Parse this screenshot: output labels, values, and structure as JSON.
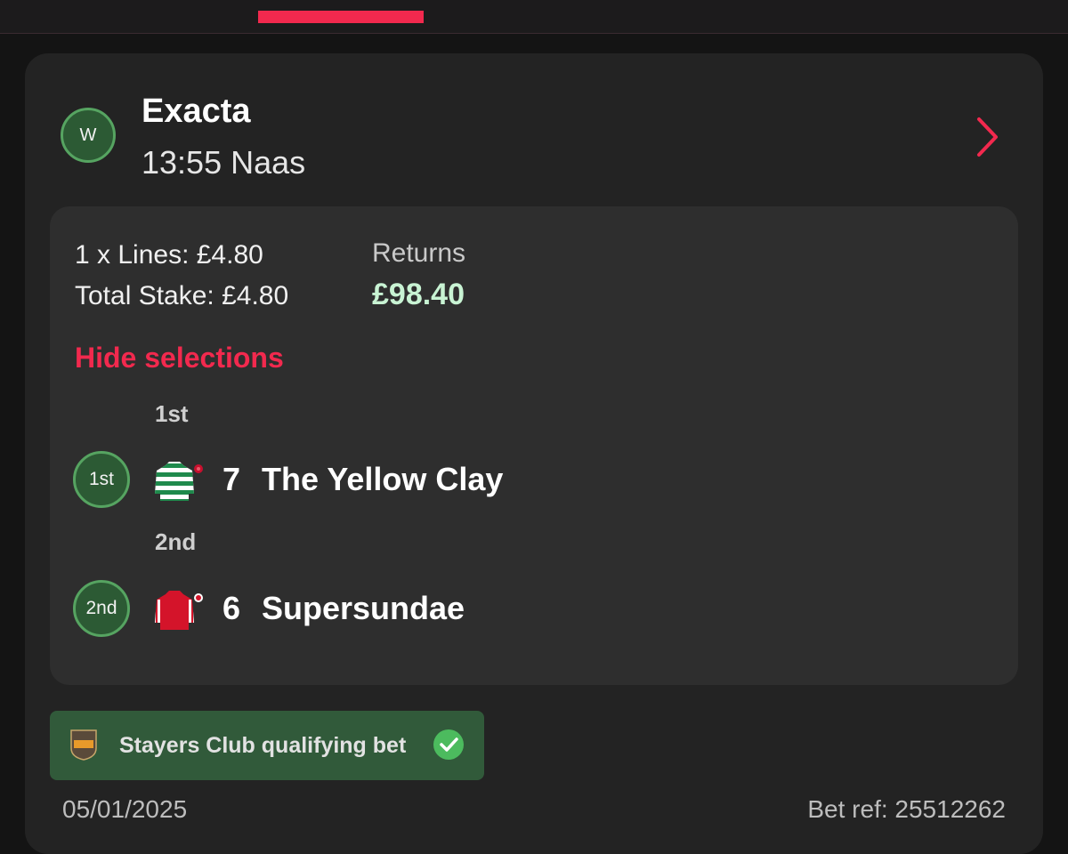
{
  "bet": {
    "status_badge": "W",
    "title": "Exacta",
    "subtitle": "13:55 Naas"
  },
  "summary": {
    "lines": "1 x Lines: £4.80",
    "total_stake": "Total Stake: £4.80",
    "returns_label": "Returns",
    "returns_value": "£98.40",
    "hide_selections": "Hide selections"
  },
  "selections": [
    {
      "position_label": "1st",
      "badge": "1st",
      "silk_icon": "green-white-hooped-silks-icon",
      "number": "7",
      "name": "The Yellow Clay"
    },
    {
      "position_label": "2nd",
      "badge": "2nd",
      "silk_icon": "red-white-striped-silks-icon",
      "number": "6",
      "name": "Supersundae"
    }
  ],
  "club": {
    "logo_icon": "stayers-club-shield-icon",
    "text": "Stayers Club qualifying bet",
    "check_icon": "green-check-icon"
  },
  "footer": {
    "date": "05/01/2025",
    "bet_ref": "Bet ref: 25512262"
  },
  "colors": {
    "accent": "#f2294e",
    "win_green": "#56a461",
    "returns_green": "#c8f3d3",
    "background": "#141414",
    "card": "#232323",
    "inner": "#2e2e2e"
  }
}
